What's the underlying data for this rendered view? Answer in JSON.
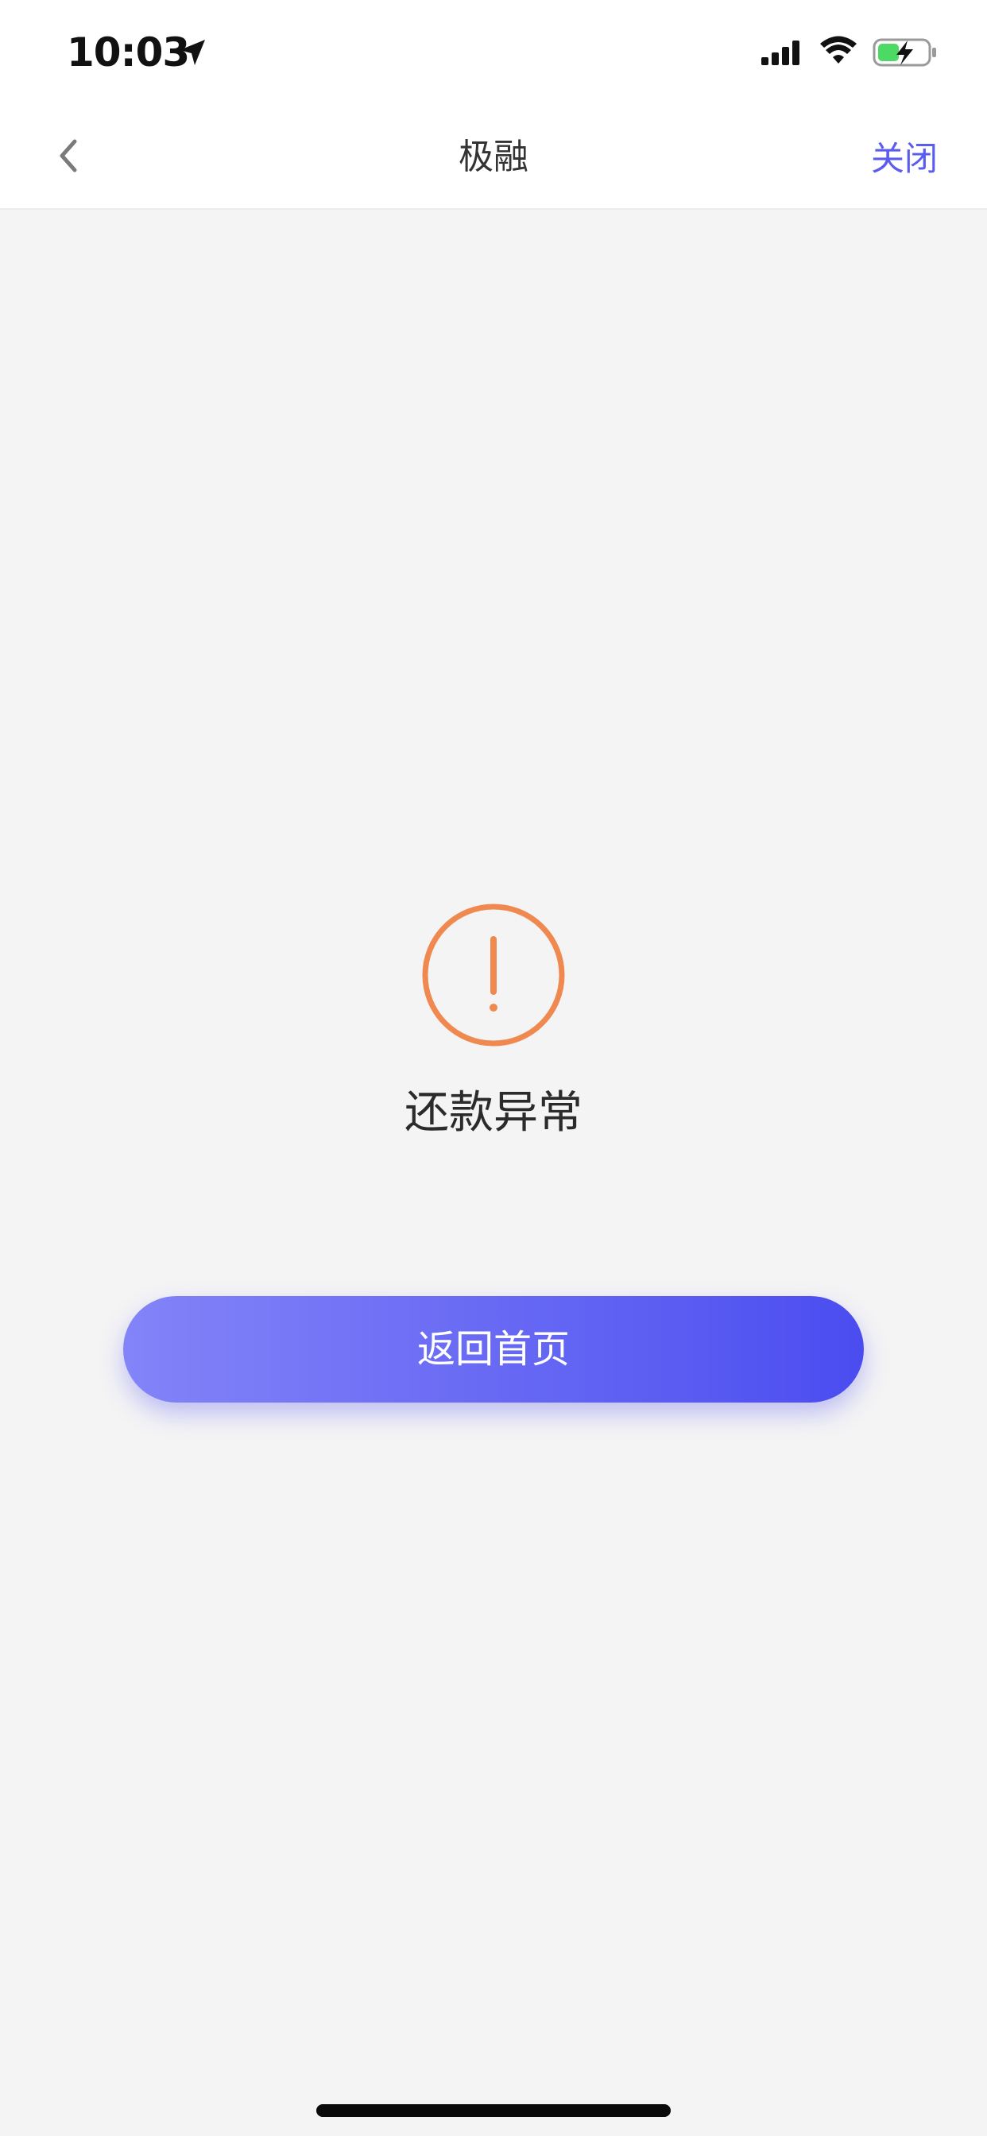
{
  "status_bar": {
    "time": "10:03"
  },
  "nav": {
    "title": "极融",
    "close_label": "关闭"
  },
  "result": {
    "message": "还款异常"
  },
  "actions": {
    "home_label": "返回首页"
  },
  "colors": {
    "accent": "#5a5cf0",
    "warning": "#f0894f",
    "background": "#f4f4f5"
  }
}
